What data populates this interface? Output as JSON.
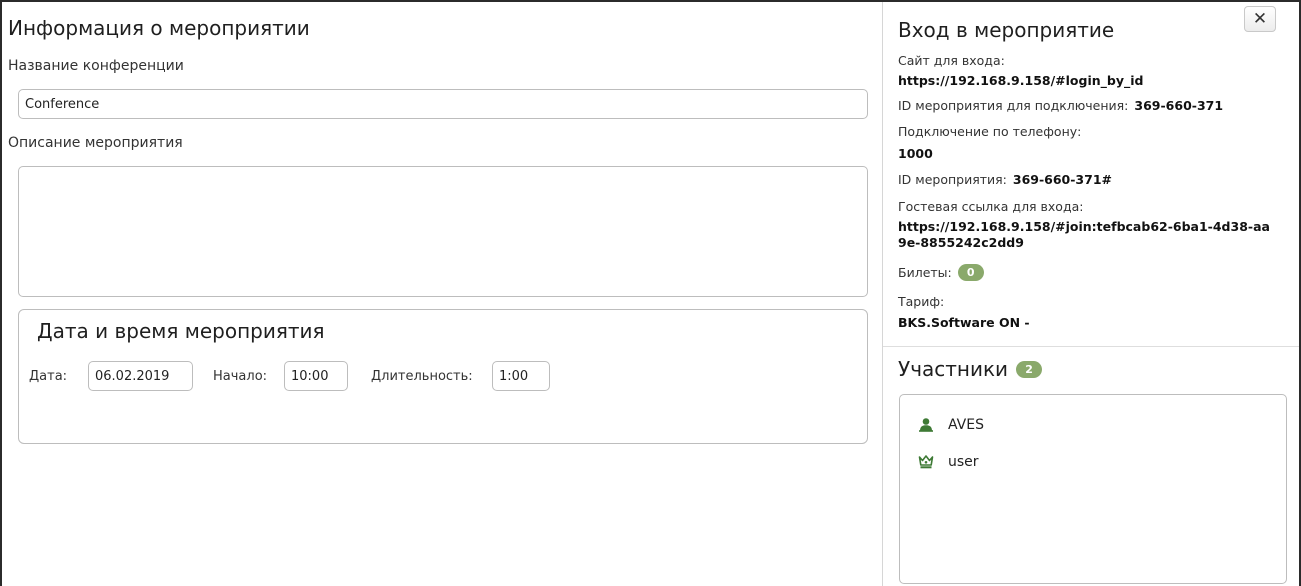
{
  "event_info": {
    "title": "Информация о мероприятии",
    "conference_name_label": "Название конференции",
    "conference_name_value": "Conference",
    "description_label": "Описание мероприятия",
    "description_value": ""
  },
  "datetime": {
    "title": "Дата и время мероприятия",
    "date_label": "Дата:",
    "date_value": "06.02.2019",
    "start_label": "Начало:",
    "start_value": "10:00",
    "duration_label": "Длительность:",
    "duration_value": "1:00"
  },
  "login": {
    "title": "Вход в мероприятие",
    "close_label": "✕",
    "site_label": "Сайт для входа:",
    "site_value": "https://192.168.9.158/#login_by_id",
    "event_id_connect_label": "ID мероприятия для подключения:",
    "event_id_connect_value": "369-660-371",
    "phone_label": "Подключение по телефону:",
    "phone_value": "1000",
    "event_id_label": "ID мероприятия:",
    "event_id_value": "369-660-371#",
    "guest_link_label": "Гостевая ссылка для входа:",
    "guest_link_value": "https://192.168.9.158/#join:tefbcab62-6ba1-4d38-aa9e-8855242c2dd9",
    "tickets_label": "Билеты:",
    "tickets_count": "0",
    "tariff_label": "Тариф:",
    "tariff_value": "BKS.Software ON -"
  },
  "participants": {
    "title": "Участники",
    "count": "2",
    "items": [
      {
        "name": "AVES",
        "icon": "user-icon"
      },
      {
        "name": "user",
        "icon": "crown-icon"
      }
    ]
  },
  "colors": {
    "badge": "#8aa96b",
    "icon_green": "#3e7a35",
    "border": "#bdbdbd"
  }
}
